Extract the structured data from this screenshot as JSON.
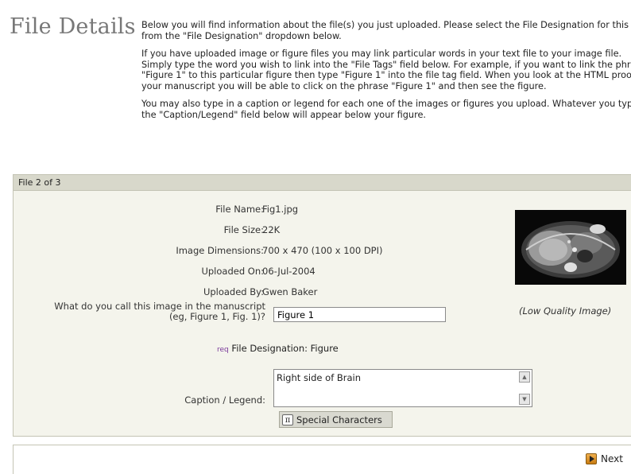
{
  "header": {
    "title": "File Details",
    "intro_paragraphs": [
      "Below you will find information about the file(s) you just uploaded. Please select the File Designation for this file from the \"File Designation\" dropdown below.",
      "If you have uploaded image or figure files you may link particular words in your text file to your image file. Simply type the word you wish to link into the \"File Tags\" field below. For example, if you want to link the phrase \"Figure 1\" to this particular figure then type \"Figure 1\" into the file tag field. When you look at the HTML proof of your manuscript you will be able to click on the phrase \"Figure 1\" and then see the figure.",
      "You may also type in a caption or legend for each one of the images or figures you upload. Whatever you type in the \"Caption/Legend\" field below will appear below your figure."
    ]
  },
  "file": {
    "panel_title": "File 2 of 3",
    "labels": {
      "file_name": "File Name:",
      "file_size": "File Size:",
      "dimensions": "Image Dimensions:",
      "uploaded_on": "Uploaded On:",
      "uploaded_by": "Uploaded By:",
      "manuscript_name_line1": "What do you call this image in the manuscript",
      "manuscript_name_line2": "(eg, Figure 1, Fig. 1)?",
      "caption": "Caption / Legend:"
    },
    "values": {
      "file_name": "Fig1.jpg",
      "file_size": "22K",
      "dimensions": "700 x 470 (100 x 100 DPI)",
      "uploaded_on": "06-Jul-2004",
      "uploaded_by": "Gwen Baker",
      "manuscript_name": "Figure 1",
      "caption": "Right side of Brain"
    },
    "designation": {
      "req": "req",
      "text": "File Designation: Figure"
    },
    "image_quality_note": "(Low Quality Image)",
    "special_chars_label": "Special Characters",
    "icons": {
      "special": "pi-icon",
      "scroll_up": "scroll-up-icon",
      "scroll_down": "scroll-down-icon"
    }
  },
  "footer": {
    "next_label": "Next",
    "next_icon": "next-arrow-icon"
  }
}
